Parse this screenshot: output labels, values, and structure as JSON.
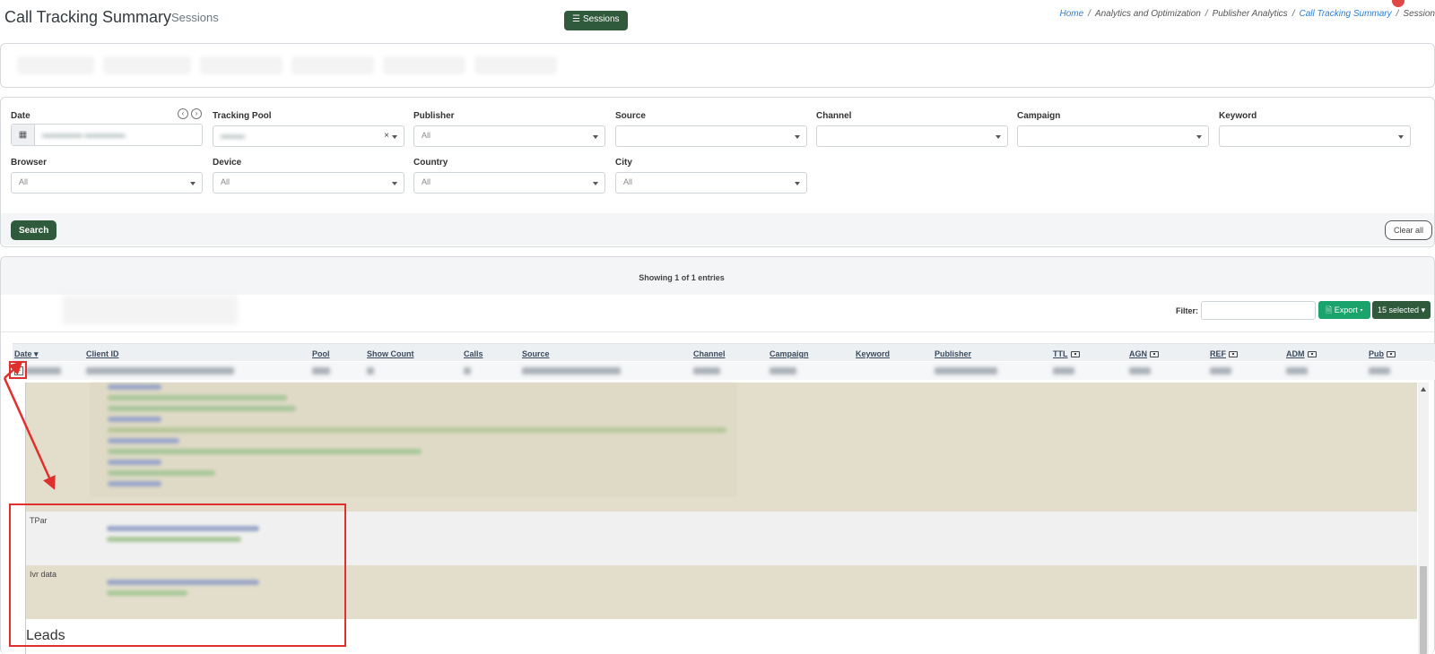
{
  "header": {
    "title": "Call Tracking Summary",
    "subtitle": "Sessions",
    "breadcrumb": {
      "home": "Home",
      "analytics": "Analytics and Optimization",
      "publisher": "Publisher Analytics",
      "summary": "Call Tracking Summary",
      "current": "Session"
    }
  },
  "tabs": {
    "active_label": "Sessions"
  },
  "filters": {
    "date_label": "Date",
    "tracking_pool_label": "Tracking Pool",
    "publisher_label": "Publisher",
    "publisher_value": "All",
    "source_label": "Source",
    "channel_label": "Channel",
    "campaign_label": "Campaign",
    "keyword_label": "Keyword",
    "browser_label": "Browser",
    "browser_value": "All",
    "device_label": "Device",
    "device_value": "All",
    "country_label": "Country",
    "country_value": "All",
    "city_label": "City",
    "city_value": "All",
    "search_button": "Search",
    "clear_button": "Clear all"
  },
  "results": {
    "showing": "Showing 1 of 1 entries",
    "filter_label": "Filter:",
    "export_button": "Export",
    "selected_button": "15 selected",
    "columns": [
      "Date",
      "Client ID",
      "Pool",
      "Show Count",
      "Calls",
      "Source",
      "Channel",
      "Campaign",
      "Keyword",
      "Publisher",
      "TTL",
      "AGN",
      "REF",
      "ADM",
      "Pub"
    ]
  },
  "detail": {
    "tpar_label": "TPar",
    "ivr_label": "Ivr data",
    "leads_title": "Leads"
  },
  "colors": {
    "primary_dark_green": "#2f5a3c",
    "export_green": "#1aa36b",
    "detail_olive": "#e3decb",
    "annotation_red": "#e0302d",
    "link_blue": "#2d7fd6"
  }
}
